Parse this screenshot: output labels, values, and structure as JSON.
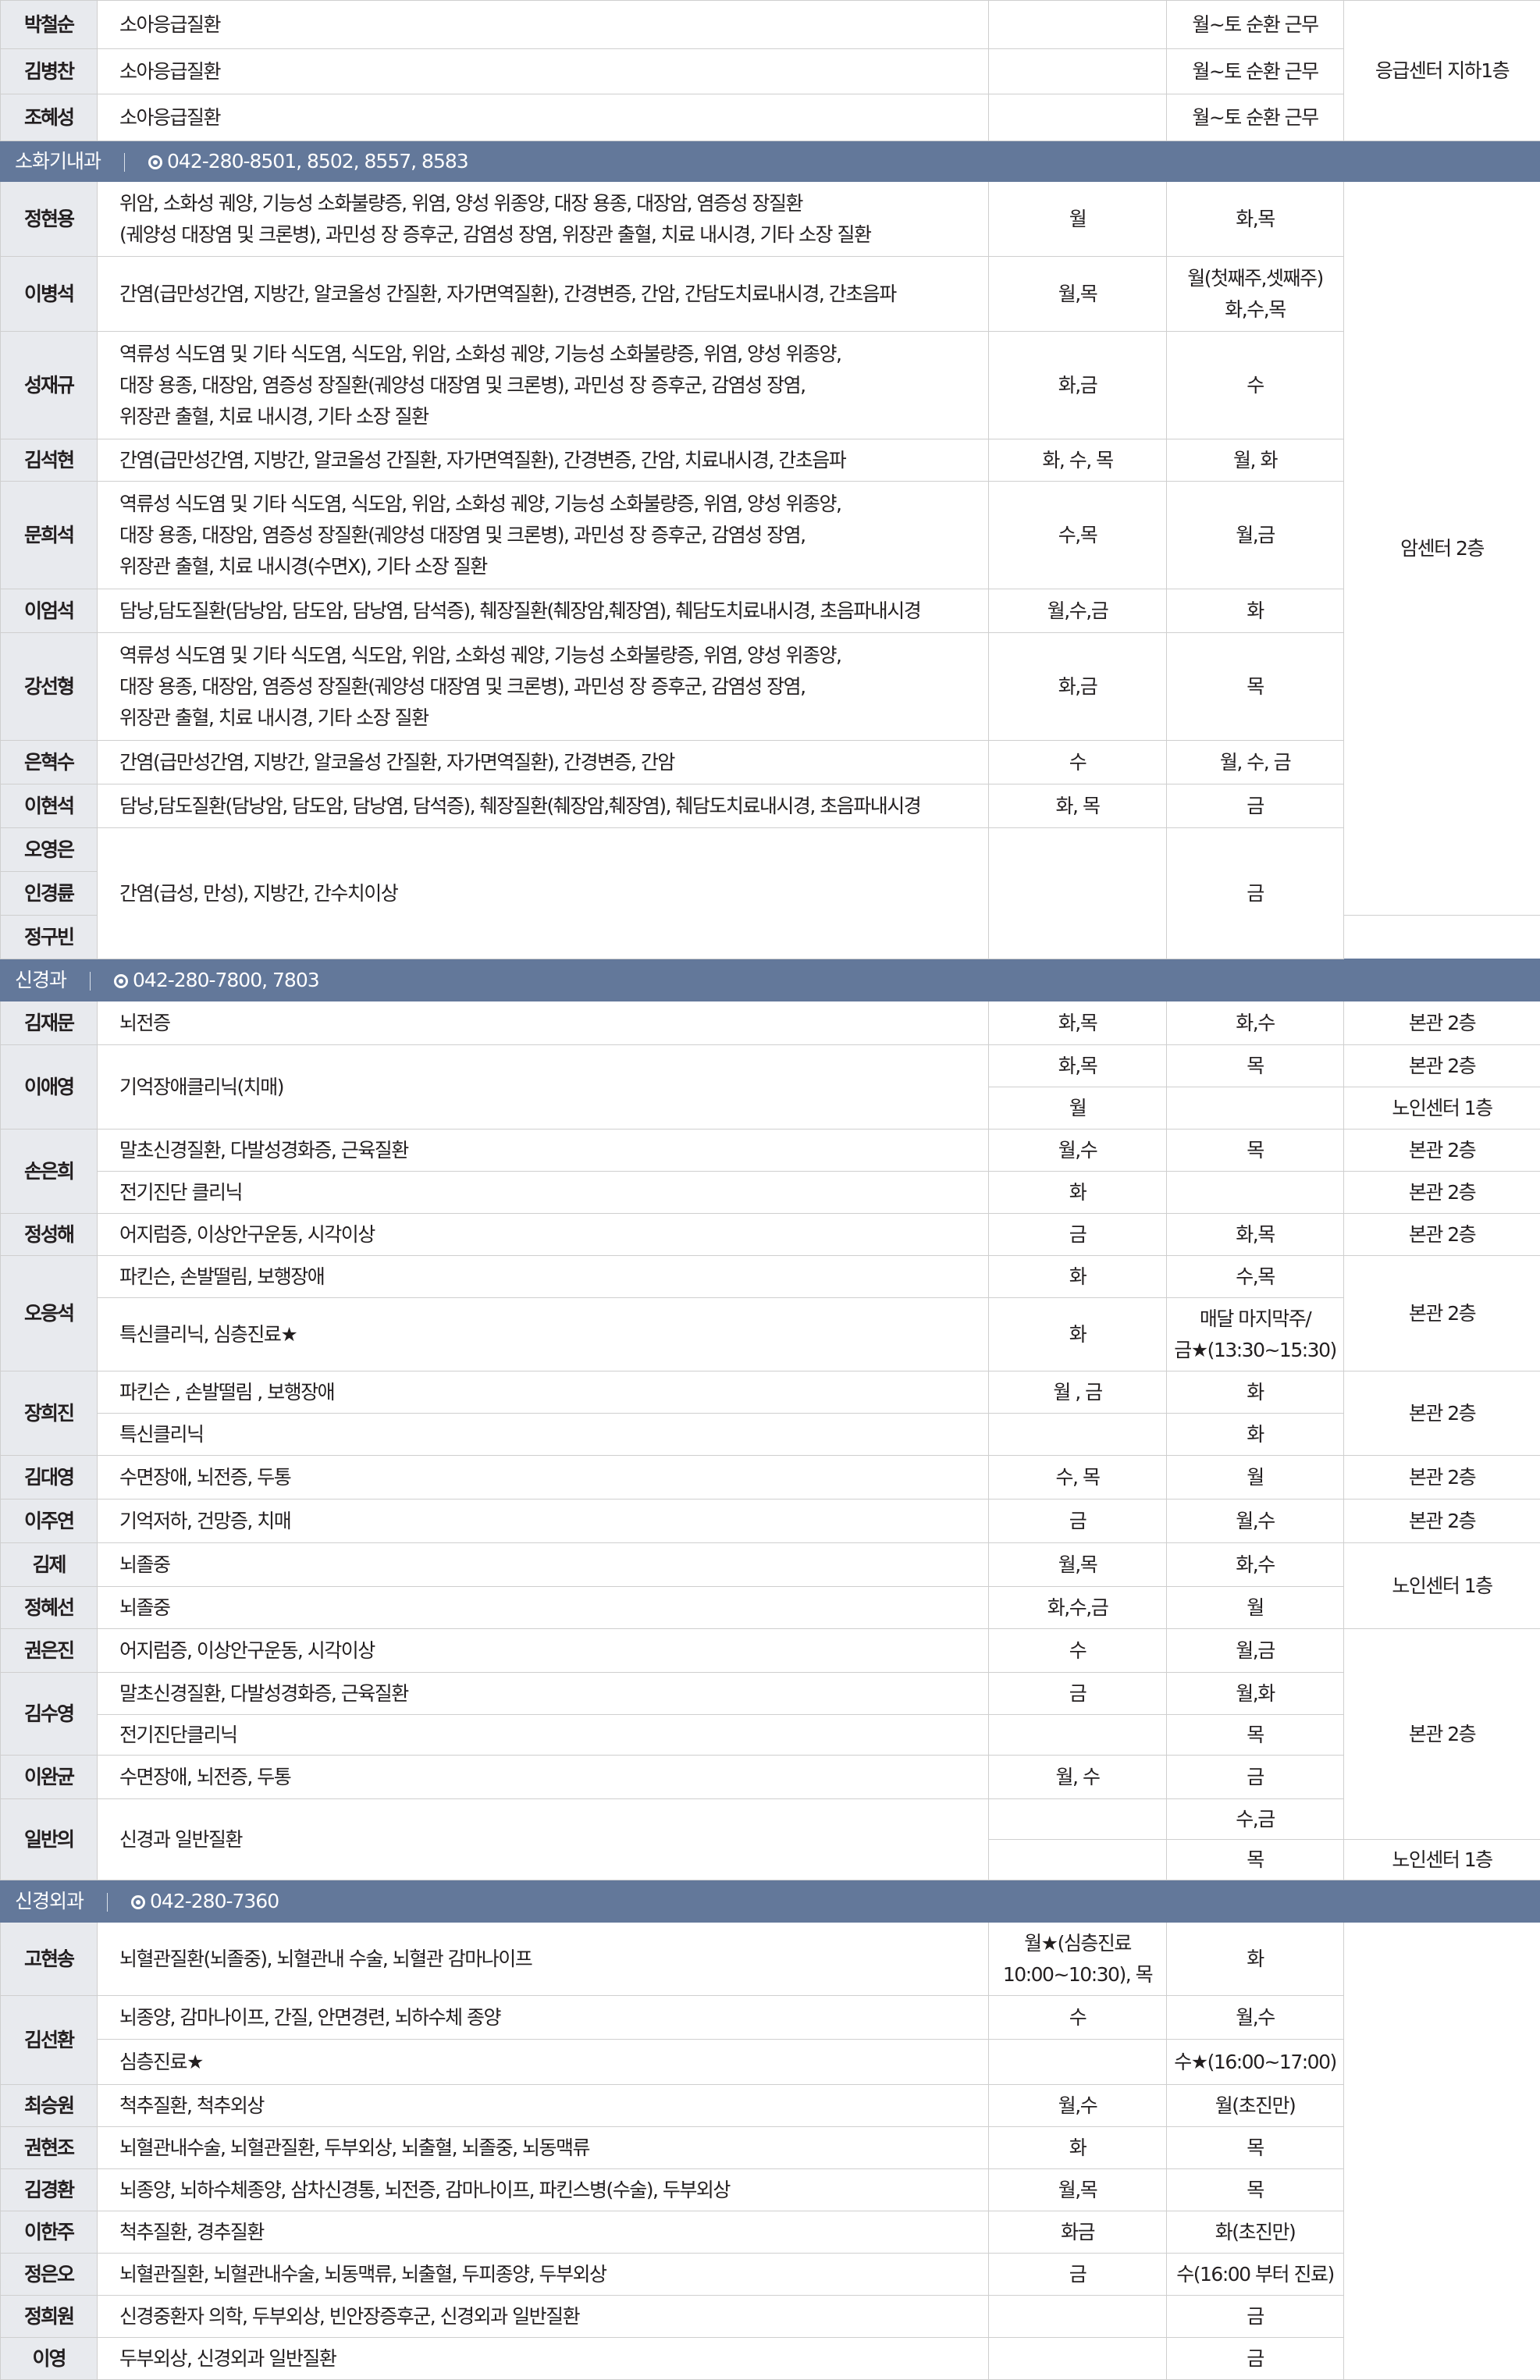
{
  "rows": [
    {
      "kind": "doc",
      "name": "박철순",
      "desc": "소아응급질환",
      "op": "",
      "clinic": "월~토 순환 근무",
      "loc": "응급센터 지하1층",
      "locspan": 3,
      "h": 62
    },
    {
      "kind": "doc",
      "name": "김병찬",
      "desc": "소아응급질환",
      "op": "",
      "clinic": "월~토 순환 근무",
      "h": 58
    },
    {
      "kind": "doc",
      "name": "조혜성",
      "desc": "소아응급질환",
      "op": "",
      "clinic": "월~토 순환 근무",
      "h": 60
    },
    {
      "kind": "sec",
      "title": "소화기내과",
      "phone": "042-280-8501, 8502, 8557, 8583",
      "h": 52
    },
    {
      "kind": "doc",
      "name": "정현용",
      "desc": [
        "위암, 소화성 궤양, 기능성 소화불량증, 위염, 양성 위종양, 대장 용종, 대장암, 염증성 장질환",
        "(궤양성 대장염 및 크론병), 과민성 장 증후군, 감염성 장염, 위장관 출혈, 치료 내시경, 기타 소장 질환"
      ],
      "op": "월",
      "clinic": "화,목",
      "loc": "암센터 2층",
      "locspan": 11,
      "h": 96
    },
    {
      "kind": "doc",
      "name": "이병석",
      "desc": "간염(급만성간염, 지방간, 알코올성 간질환, 자가면역질환), 간경변증, 간암, 간담도치료내시경, 간초음파",
      "op": "월,목",
      "clinic": [
        "월(첫째주,셋째주)",
        "화,수,목"
      ],
      "h": 96
    },
    {
      "kind": "doc",
      "name": "성재규",
      "desc": [
        "역류성 식도염 및 기타 식도염, 식도암, 위암, 소화성 궤양, 기능성 소화불량증, 위염, 양성 위종양,",
        "대장 용종, 대장암, 염증성 장질환(궤양성 대장염 및 크론병), 과민성 장 증후군, 감염성 장염,",
        "위장관 출혈, 치료 내시경, 기타 소장 질환"
      ],
      "op": "화,금",
      "clinic": "수",
      "h": 138
    },
    {
      "kind": "doc",
      "name": "김석현",
      "desc": "간염(급만성간염, 지방간, 알코올성 간질환, 자가면역질환), 간경변증, 간암, 치료내시경, 간초음파",
      "op": "화, 수, 목",
      "clinic": "월, 화",
      "h": 54
    },
    {
      "kind": "doc",
      "name": "문희석",
      "desc": [
        "역류성 식도염 및 기타 식도염, 식도암, 위암, 소화성 궤양, 기능성 소화불량증, 위염, 양성 위종양,",
        "대장 용종, 대장암, 염증성 장질환(궤양성 대장염 및 크론병), 과민성 장 증후군, 감염성 장염,",
        "위장관 출혈, 치료 내시경(수면X), 기타 소장 질환"
      ],
      "op": "수,목",
      "clinic": "월,금",
      "h": 138
    },
    {
      "kind": "doc",
      "name": "이엄석",
      "desc": "담낭,담도질환(담낭암, 담도암, 담낭염, 담석증), 췌장질환(췌장암,췌장염), 췌담도치료내시경, 초음파내시경",
      "op": "월,수,금",
      "clinic": "화",
      "h": 56
    },
    {
      "kind": "doc",
      "name": "강선형",
      "desc": [
        "역류성 식도염 및 기타 식도염, 식도암, 위암, 소화성 궤양, 기능성 소화불량증, 위염, 양성 위종양,",
        "대장 용종, 대장암, 염증성 장질환(궤양성 대장염 및 크론병), 과민성 장 증후군, 감염성 장염,",
        "위장관 출혈, 치료 내시경, 기타 소장 질환"
      ],
      "op": "화,금",
      "clinic": "목",
      "h": 138
    },
    {
      "kind": "doc",
      "name": "은혁수",
      "desc": "간염(급만성간염, 지방간, 알코올성 간질환, 자가면역질환), 간경변증, 간암",
      "op": "수",
      "clinic": "월, 수, 금",
      "h": 56
    },
    {
      "kind": "doc",
      "name": "이현석",
      "desc": "담낭,담도질환(담낭암, 담도암, 담낭염, 담석증), 췌장질환(췌장암,췌장염), 췌담도치료내시경, 초음파내시경",
      "op": "화, 목",
      "clinic": "금",
      "h": 56
    },
    {
      "kind": "group",
      "names": [
        "오영은",
        "인경륜",
        "정구빈"
      ],
      "desc": "간염(급성, 만성), 지방간, 간수치이상",
      "op": "",
      "clinic": "금",
      "h": 56
    },
    {
      "kind": "sec",
      "title": "신경과",
      "phone": "042-280-7800, 7803",
      "h": 54
    },
    {
      "kind": "doc",
      "name": "김재문",
      "desc": "뇌전증",
      "op": "화,목",
      "clinic": "화,수",
      "loc": "본관 2층",
      "h": 56
    },
    {
      "kind": "sub",
      "name": "이애영",
      "desc": "기억장애클리닉(치매)",
      "subs": [
        {
          "op": "화,목",
          "clinic": "목",
          "loc": "본관 2층"
        },
        {
          "op": "월",
          "clinic": "",
          "loc": "노인센터 1층"
        }
      ],
      "h": 54
    },
    {
      "kind": "sub2",
      "name": "손은희",
      "subs": [
        {
          "desc": "말초신경질환, 다발성경화증, 근육질환",
          "op": "월,수",
          "clinic": "목",
          "loc": "본관 2층"
        },
        {
          "desc": "전기진단 클리닉",
          "op": "화",
          "clinic": "",
          "loc": "본관 2층"
        }
      ],
      "h": 54
    },
    {
      "kind": "doc",
      "name": "정성해",
      "desc": "어지럼증, 이상안구운동, 시각이상",
      "op": "금",
      "clinic": "화,목",
      "loc": "본관 2층",
      "h": 54
    },
    {
      "kind": "sub3",
      "name": "오응석",
      "loc": "본관 2층",
      "subs": [
        {
          "desc": "파킨슨, 손발떨림, 보행장애",
          "op": "화",
          "clinic": "수,목",
          "h": 54
        },
        {
          "desc": "특신클리닉, 심층진료★",
          "op": "화",
          "clinic": [
            "매달 마지막주/",
            "금★(13:30~15:30)"
          ],
          "h": 94
        }
      ]
    },
    {
      "kind": "sub3",
      "name": "장희진",
      "loc": "본관 2층",
      "subs": [
        {
          "desc": "파킨슨 , 손발떨림 , 보행장애",
          "op": "월 , 금",
          "clinic": "화",
          "h": 54
        },
        {
          "desc": "특신클리닉",
          "op": "",
          "clinic": "화",
          "h": 54
        }
      ]
    },
    {
      "kind": "doc",
      "name": "김대영",
      "desc": "수면장애, 뇌전증, 두통",
      "op": "수, 목",
      "clinic": "월",
      "loc": "본관 2층",
      "h": 56
    },
    {
      "kind": "doc",
      "name": "이주연",
      "desc": "기억저하, 건망증, 치매",
      "op": "금",
      "clinic": "월,수",
      "loc": "본관 2층",
      "h": 56
    },
    {
      "kind": "doc",
      "name": "김제",
      "desc": "뇌졸중",
      "op": "월,목",
      "clinic": "화,수",
      "loc": "노인센터 1층",
      "locspan": 2,
      "h": 56
    },
    {
      "kind": "doc",
      "name": "정혜선",
      "desc": "뇌졸중",
      "op": "화,수,금",
      "clinic": "월",
      "h": 54
    },
    {
      "kind": "doc",
      "name": "권은진",
      "desc": "어지럼증, 이상안구운동, 시각이상",
      "op": "수",
      "clinic": "월,금",
      "loc": "본관 2층",
      "locspan": 5,
      "h": 56
    },
    {
      "kind": "sub4",
      "name": "김수영",
      "subs": [
        {
          "desc": "말초신경질환, 다발성경화증, 근육질환",
          "op": "금",
          "clinic": "월,화",
          "h": 54
        },
        {
          "desc": "전기진단클리닉",
          "op": "",
          "clinic": "목",
          "h": 52
        }
      ]
    },
    {
      "kind": "doc",
      "name": "이완균",
      "desc": "수면장애, 뇌전증, 두통",
      "op": "월, 수",
      "clinic": "금",
      "h": 56
    },
    {
      "kind": "sub5",
      "name": "일반의",
      "desc": "신경과 일반질환",
      "subs": [
        {
          "op": "",
          "clinic": "수,금",
          "loc": "본관 2층"
        },
        {
          "op": "",
          "clinic": "목",
          "loc": "노인센터 1층"
        }
      ],
      "h": 52
    },
    {
      "kind": "sec",
      "title": "신경외과",
      "phone": "042-280-7360",
      "h": 54
    },
    {
      "kind": "doc",
      "name": "고현송",
      "desc": "뇌혈관질환(뇌졸중), 뇌혈관내 수술, 뇌혈관 감마나이프",
      "op": [
        "월★(심층진료",
        "10:00~10:30), 목"
      ],
      "clinic": "화",
      "loc": "",
      "locspan": 12,
      "h": 94
    },
    {
      "kind": "sub4",
      "name": "김선환",
      "subs": [
        {
          "desc": "뇌종양, 감마나이프, 간질, 안면경련, 뇌하수체 종양",
          "op": "수",
          "clinic": "월,수",
          "h": 56
        },
        {
          "desc": "심층진료★",
          "op": "",
          "clinic": "수★(16:00~17:00)",
          "h": 58
        }
      ]
    },
    {
      "kind": "doc",
      "name": "최승원",
      "desc": "척추질환, 척추외상",
      "op": "월,수",
      "clinic": "월(초진만)",
      "h": 54
    },
    {
      "kind": "doc",
      "name": "권현조",
      "desc": "뇌혈관내수술, 뇌혈관질환, 두부외상, 뇌출혈, 뇌졸중, 뇌동맥류",
      "op": "화",
      "clinic": "목",
      "h": 54
    },
    {
      "kind": "doc",
      "name": "김경환",
      "desc": "뇌종양, 뇌하수체종양, 삼차신경통, 뇌전증, 감마나이프, 파킨스병(수술), 두부외상",
      "op": "월,목",
      "clinic": "목",
      "h": 54
    },
    {
      "kind": "doc",
      "name": "이한주",
      "desc": "척추질환, 경추질환",
      "op": "화금",
      "clinic": "화(초진만)",
      "h": 54
    },
    {
      "kind": "doc",
      "name": "정은오",
      "desc": "뇌혈관질환, 뇌혈관내수술, 뇌동맥류, 뇌출혈, 두피종양, 두부외상",
      "op": "금",
      "clinic": "수(16:00 부터 진료)",
      "h": 54
    },
    {
      "kind": "doc",
      "name": "정희원",
      "desc": "신경중환자 의학, 두부외상, 빈안장증후군, 신경외과 일반질환",
      "op": "",
      "clinic": "금",
      "h": 54
    },
    {
      "kind": "doc",
      "name": "이영",
      "desc": "두부외상, 신경외과 일반질환",
      "op": "",
      "clinic": "금",
      "h": 54
    }
  ]
}
